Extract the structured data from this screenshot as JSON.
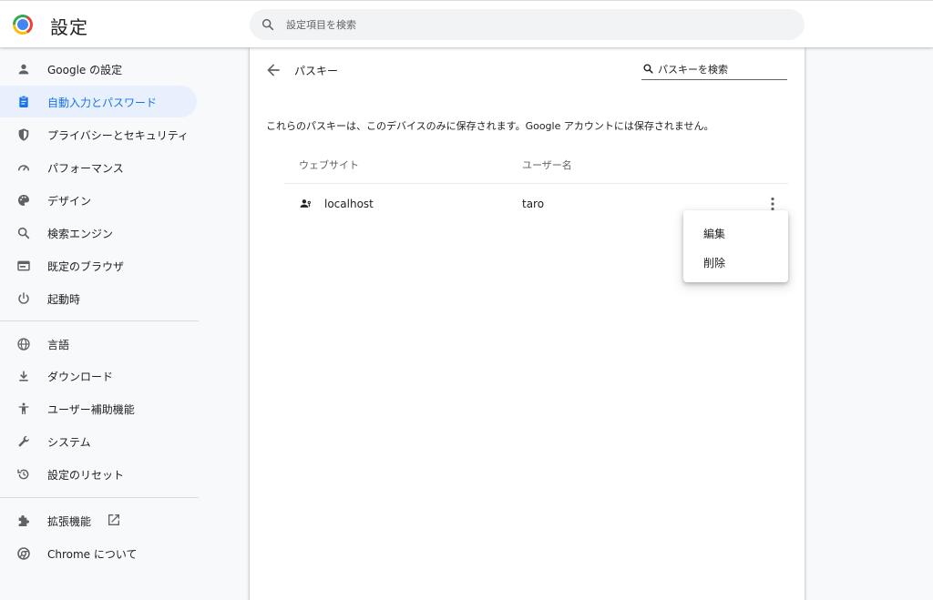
{
  "header": {
    "title": "設定",
    "search_placeholder": "設定項目を検索"
  },
  "sidebar": {
    "items": [
      {
        "label": "Google の設定",
        "icon": "person-icon"
      },
      {
        "label": "自動入力とパスワード",
        "icon": "clipboard-icon",
        "active": true
      },
      {
        "label": "プライバシーとセキュリティ",
        "icon": "shield-icon"
      },
      {
        "label": "パフォーマンス",
        "icon": "speedometer-icon"
      },
      {
        "label": "デザイン",
        "icon": "palette-icon"
      },
      {
        "label": "検索エンジン",
        "icon": "search-icon"
      },
      {
        "label": "既定のブラウザ",
        "icon": "browser-icon"
      },
      {
        "label": "起動時",
        "icon": "power-icon"
      },
      {
        "label": "言語",
        "icon": "globe-icon"
      },
      {
        "label": "ダウンロード",
        "icon": "download-icon"
      },
      {
        "label": "ユーザー補助機能",
        "icon": "accessibility-icon"
      },
      {
        "label": "システム",
        "icon": "wrench-icon"
      },
      {
        "label": "設定のリセット",
        "icon": "restore-icon"
      },
      {
        "label": "拡張機能",
        "icon": "puzzle-icon"
      },
      {
        "label": "Chrome について",
        "icon": "chrome-icon"
      }
    ]
  },
  "main": {
    "title": "パスキー",
    "search_placeholder": "パスキーを検索",
    "description": "これらのパスキーは、このデバイスのみに保存されます。Google アカウントには保存されません。",
    "columns": [
      "ウェブサイト",
      "ユーザー名"
    ],
    "rows": [
      {
        "site": "localhost",
        "username": "taro"
      }
    ]
  },
  "menu": {
    "items": [
      "編集",
      "削除"
    ]
  },
  "colors": {
    "accent": "#1a73e8",
    "active_bg": "#e8f0fe",
    "icon": "#5f6368"
  }
}
